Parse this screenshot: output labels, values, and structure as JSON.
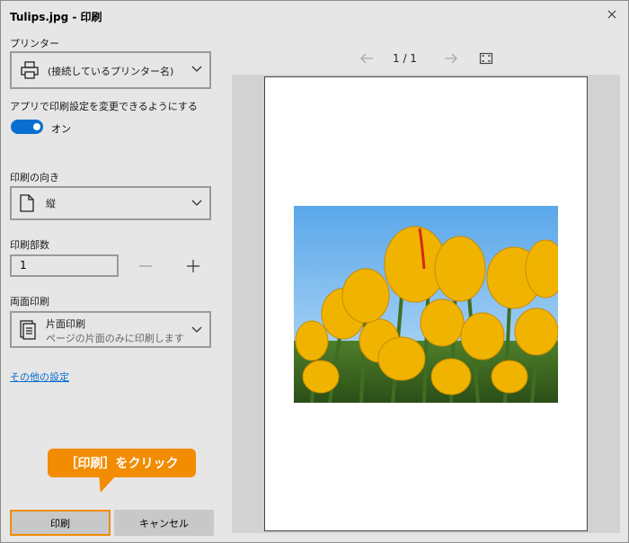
{
  "window": {
    "title": "Tulips.jpg - 印刷"
  },
  "printer": {
    "label": "プリンター",
    "value": "(接続しているプリンター名)"
  },
  "app_settings": {
    "label": "アプリで印刷設定を変更できるようにする",
    "toggle_state": "オン",
    "enabled": true
  },
  "orientation": {
    "label": "印刷の向き",
    "value": "縦"
  },
  "copies": {
    "label": "印刷部数",
    "value": "1"
  },
  "duplex": {
    "label": "両面印刷",
    "value": "片面印刷",
    "description": "ページの片面のみに印刷します"
  },
  "more_settings": {
    "label": "その他の設定"
  },
  "callout": {
    "text": "［印刷］をクリック"
  },
  "buttons": {
    "print": "印刷",
    "cancel": "キャンセル"
  },
  "preview": {
    "page_indicator": "1 / 1"
  },
  "colors": {
    "accent": "#0a6ed1",
    "highlight": "#f28c00"
  },
  "icons": {
    "close": "close-icon",
    "printer": "printer-icon",
    "page": "page-icon",
    "duplex": "single-sided-icon",
    "chevron": "chevron-down-icon",
    "prev": "arrow-left-icon",
    "next": "arrow-right-icon",
    "fit": "fit-page-icon"
  }
}
